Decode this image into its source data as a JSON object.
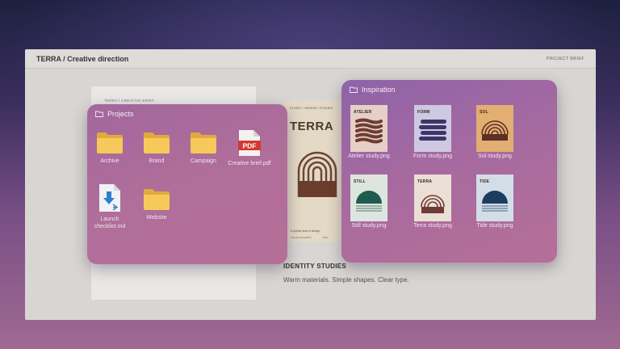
{
  "window": {
    "title": "TERRA / Creative direction",
    "tag": "PROJECT BRIEF"
  },
  "doc": {
    "label": "TERRA / CREATIVE BRIEF"
  },
  "poster": {
    "small": "STUDIO / GRAPHIC STUDIES",
    "title": "TERRA",
    "tagline": "A quieter kind of design",
    "meta1": "VALUE OF EARTH",
    "meta2": "2024"
  },
  "studies": {
    "heading": "IDENTITY STUDIES",
    "subtitle": "Warm materials. Simple shapes. Clear type."
  },
  "projects": {
    "title": "Projects",
    "items": [
      {
        "label": "Archive",
        "icon": "folder-icon"
      },
      {
        "label": "Brand",
        "icon": "folder-icon"
      },
      {
        "label": "Campaign",
        "icon": "folder-icon"
      },
      {
        "label": "Creative brief.pdf",
        "icon": "pdf-file-icon",
        "badge": "PDF"
      },
      {
        "label": "Launch checklist.md",
        "icon": "markdown-file-icon"
      },
      {
        "label": "Website",
        "icon": "folder-icon"
      }
    ]
  },
  "inspiration": {
    "title": "Inspiration",
    "items": [
      {
        "label": "Atelier study.png",
        "thumb": "ATELIER",
        "bg": "#e6cfc6",
        "ink": "#6e3c32"
      },
      {
        "label": "Form study.png",
        "thumb": "FORM",
        "bg": "#cfc8e2",
        "ink": "#3c3568"
      },
      {
        "label": "Sol study.png",
        "thumb": "SOL",
        "bg": "#e2ae72",
        "ink": "#5c3024"
      },
      {
        "label": "Still study.png",
        "thumb": "STILL",
        "bg": "#dde5de",
        "ink": "#1f5a4e"
      },
      {
        "label": "Terra study.png",
        "thumb": "TERRA",
        "bg": "#eadfd4",
        "ink": "#6e3c32"
      },
      {
        "label": "Tide study.png",
        "thumb": "TIDE",
        "bg": "#d2dde8",
        "ink": "#1d3d5e"
      }
    ]
  }
}
